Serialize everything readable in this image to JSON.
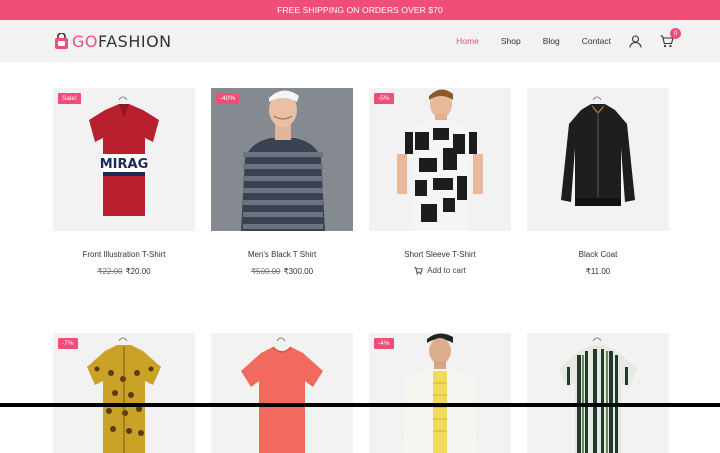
{
  "topbar": {
    "text": "FREE SHIPPING ON ORDERS OVER $70"
  },
  "header": {
    "logo_accent": "GO",
    "logo_main": "FASHION",
    "nav": [
      {
        "label": "Home",
        "active": true
      },
      {
        "label": "Shop",
        "active": false
      },
      {
        "label": "Blog",
        "active": false
      },
      {
        "label": "Contact",
        "active": false
      }
    ],
    "icons": {
      "account": "user-icon",
      "cart": "cart-icon"
    },
    "cart_count": "0"
  },
  "products": [
    {
      "badge": "Sale!",
      "name": "Front Illustration T-Shirt",
      "old_price": "₹22.00",
      "price": "₹20.00",
      "image": "red polo shirt with MIRAG print"
    },
    {
      "badge": "-40%",
      "name": "Men's Black T Shirt",
      "old_price": "₹500.00",
      "price": "₹300.00",
      "image": "man in striped long sleeve tee"
    },
    {
      "badge": "-5%",
      "name": "Short Sleeve T-Shirt",
      "add_to_cart": "Add to cart",
      "image": "man in printed short sleeve shirt"
    },
    {
      "badge": "",
      "name": "Black Coat",
      "price": "₹11.00",
      "image": "black bomber jacket"
    },
    {
      "badge": "-7%",
      "image": "yellow patterned short sleeve shirt"
    },
    {
      "badge": "",
      "image": "coral t-shirt on hanger"
    },
    {
      "badge": "-4%",
      "image": "man in white shirt over yellow tee"
    },
    {
      "badge": "",
      "image": "striped short sleeve shirt"
    }
  ],
  "colors": {
    "accent": "#f04e78",
    "header_bg": "#f2f2f2",
    "card_bg": "#f2f2f2"
  }
}
